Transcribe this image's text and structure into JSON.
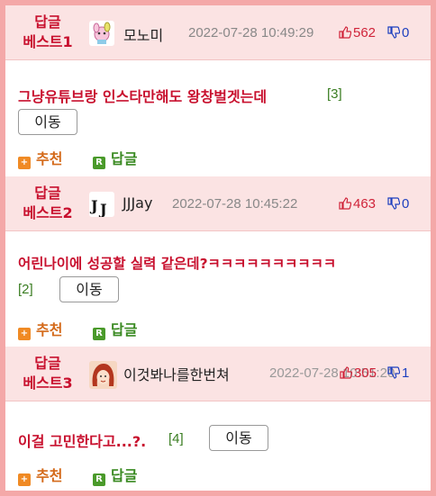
{
  "posts": [
    {
      "label_line1": "답글",
      "label_line2": "베스트1",
      "nickname": "모노미",
      "date": "2022-07-28 10:49:29",
      "likes": "562",
      "dislikes": "0",
      "title": "그냥유튜브랑 인스타만해도 왕창벌겟는데",
      "comment_count": "[3]",
      "move_label": "이동",
      "recommend_label": "추천",
      "reply_label": "답글",
      "avatar_icon": "pink-character-icon"
    },
    {
      "label_line1": "답글",
      "label_line2": "베스트2",
      "nickname": "JJJay",
      "date": "2022-07-28 10:45:22",
      "likes": "463",
      "dislikes": "0",
      "title": "어린나이에 성공할 실력 같은데?ㅋㅋㅋㅋㅋㅋㅋㅋㅋㅋ",
      "comment_count": "[2]",
      "move_label": "이동",
      "recommend_label": "추천",
      "reply_label": "답글",
      "avatar_icon": "jj-logo-icon"
    },
    {
      "label_line1": "답글",
      "label_line2": "베스트3",
      "nickname": "이것봐나를한번쳐",
      "date": "2022-07-28 10:51:20",
      "likes": "305",
      "dislikes": "1",
      "title": "이걸 고민한다고...?.",
      "comment_count": "[4]",
      "move_label": "이동",
      "recommend_label": "추천",
      "reply_label": "답글",
      "avatar_icon": "red-hair-girl-icon"
    }
  ],
  "colors": {
    "border": "#f4a8a8",
    "header_bg": "#fbe3e3",
    "accent_red": "#c8102e",
    "like_red": "#d0243a",
    "dislike_blue": "#1d3fbf",
    "count_green": "#3a7d22",
    "recommend_orange": "#d46a1a",
    "reply_green": "#3a8a22"
  }
}
